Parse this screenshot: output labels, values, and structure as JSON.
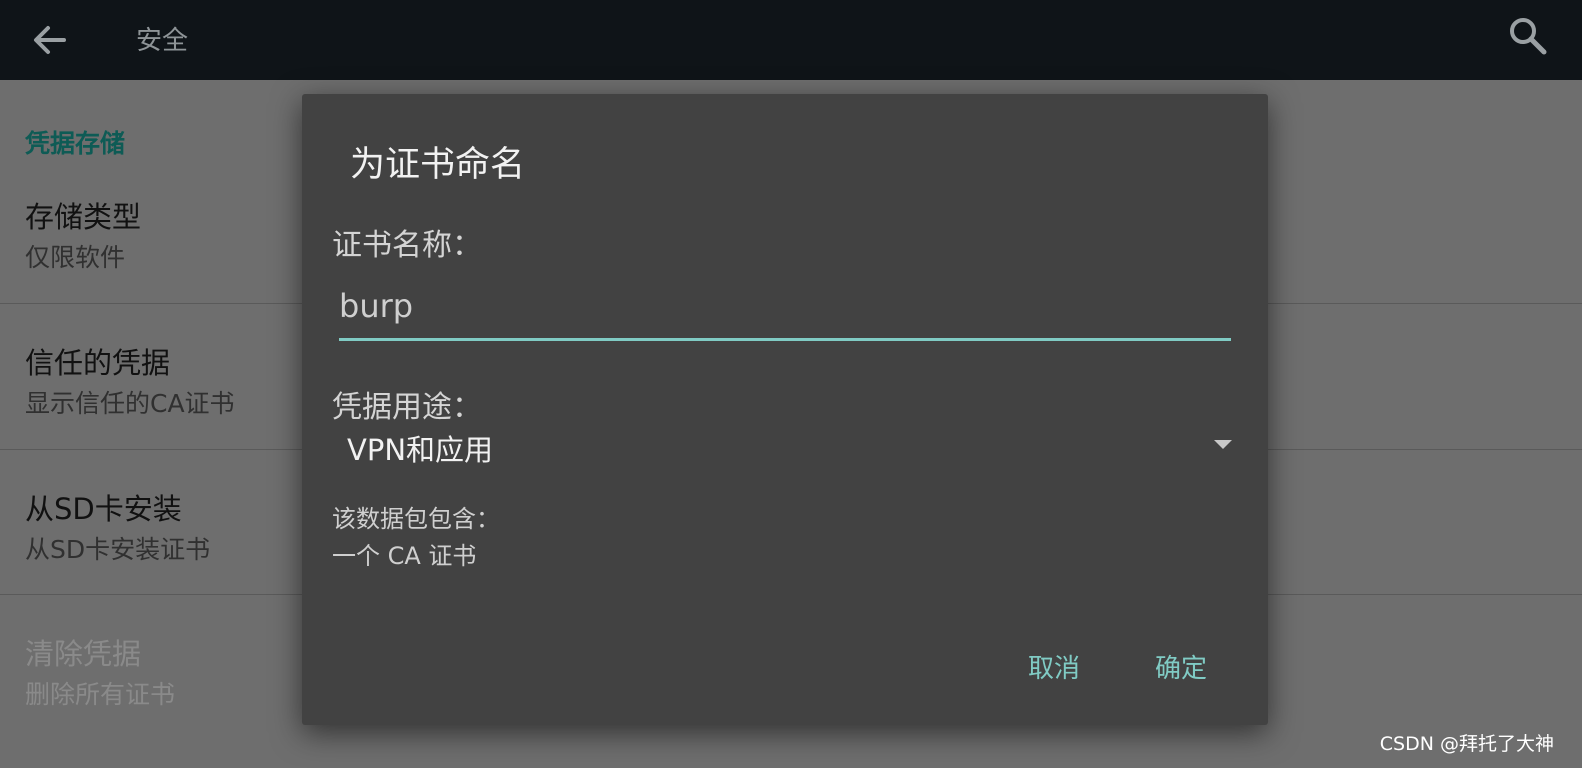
{
  "appbar": {
    "title": "安全",
    "back_icon": "arrow-left-icon",
    "search_icon": "search-icon"
  },
  "settings": {
    "section_header": "凭据存储",
    "items": [
      {
        "title": "存储类型",
        "summary": "仅限软件",
        "enabled": true
      },
      {
        "title": "信任的凭据",
        "summary": "显示信任的CA证书",
        "enabled": true
      },
      {
        "title": "从SD卡安装",
        "summary": "从SD卡安装证书",
        "enabled": true
      },
      {
        "title": "清除凭据",
        "summary": "删除所有证书",
        "enabled": false
      }
    ]
  },
  "dialog": {
    "title": "为证书命名",
    "name_label": "证书名称：",
    "name_value": "burp",
    "usage_label": "凭据用途：",
    "usage_selected": "VPN和应用",
    "contains_label": "该数据包包含：",
    "contains_value": "一个 CA 证书",
    "cancel_label": "取消",
    "ok_label": "确定"
  },
  "watermark": "CSDN @拜托了大神",
  "colors": {
    "accent": "#80cbc4",
    "appbar_bg": "#0f1418",
    "dialog_bg": "#424242",
    "section_header": "#0e5b55"
  }
}
